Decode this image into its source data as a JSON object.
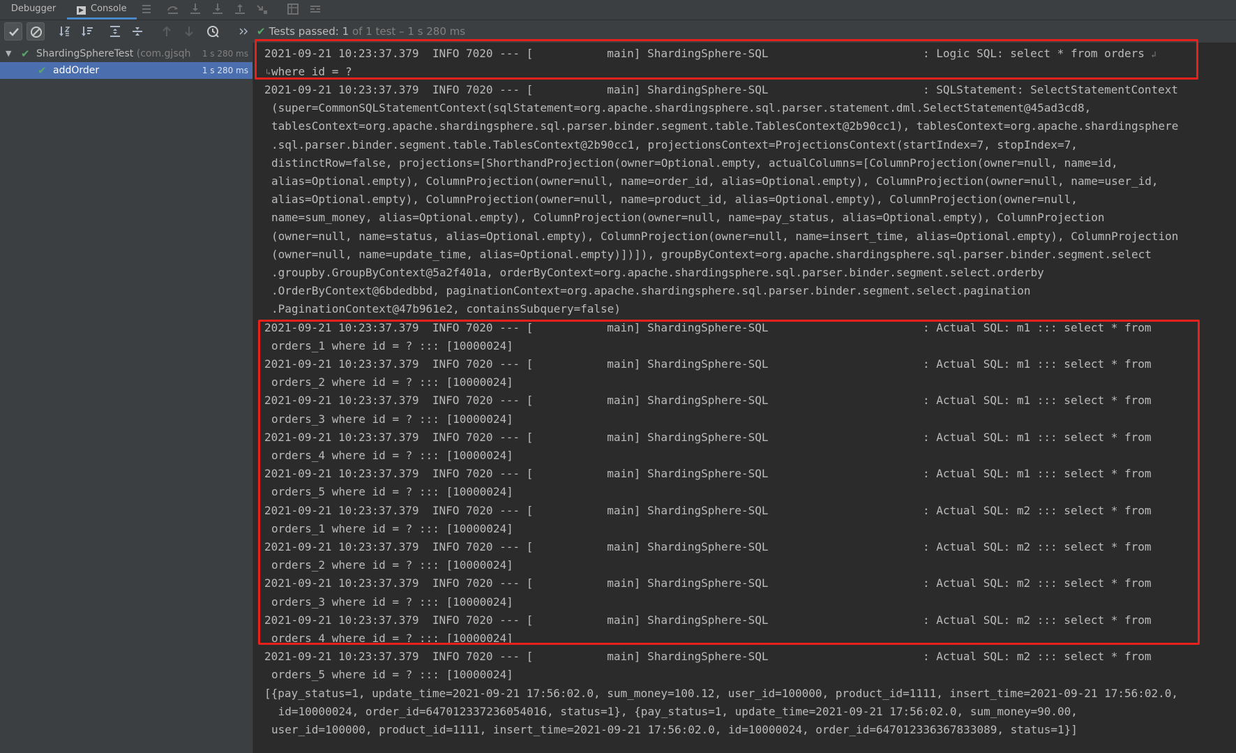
{
  "tabs": {
    "debugger": "Debugger",
    "console": "Console"
  },
  "status": {
    "prefix": "Tests passed:",
    "count": "1",
    "detail": "of 1 test – 1 s 280 ms"
  },
  "tree": {
    "root": {
      "name": "ShardingSphereTest",
      "pkg": "(com.gjsqh",
      "time": "1 s 280 ms"
    },
    "child": {
      "name": "addOrder",
      "time": "1 s 280 ms"
    }
  },
  "console": {
    "logic": {
      "line1": "2021-09-21 10:23:37.379  INFO 7020 --- [           main] ShardingSphere-SQL                       : Logic SQL: select * from orders ",
      "line2": "where id = ?"
    },
    "statement": [
      "2021-09-21 10:23:37.379  INFO 7020 --- [           main] ShardingSphere-SQL                       : SQLStatement: SelectStatementContext",
      "(super=CommonSQLStatementContext(sqlStatement=org.apache.shardingsphere.sql.parser.statement.dml.SelectStatement@45ad3cd8,",
      "tablesContext=org.apache.shardingsphere.sql.parser.binder.segment.table.TablesContext@2b90cc1), tablesContext=org.apache.shardingsphere",
      ".sql.parser.binder.segment.table.TablesContext@2b90cc1, projectionsContext=ProjectionsContext(startIndex=7, stopIndex=7,",
      "distinctRow=false, projections=[ShorthandProjection(owner=Optional.empty, actualColumns=[ColumnProjection(owner=null, name=id,",
      "alias=Optional.empty), ColumnProjection(owner=null, name=order_id, alias=Optional.empty), ColumnProjection(owner=null, name=user_id,",
      "alias=Optional.empty), ColumnProjection(owner=null, name=product_id, alias=Optional.empty), ColumnProjection(owner=null,",
      "name=sum_money, alias=Optional.empty), ColumnProjection(owner=null, name=pay_status, alias=Optional.empty), ColumnProjection",
      "(owner=null, name=status, alias=Optional.empty), ColumnProjection(owner=null, name=insert_time, alias=Optional.empty), ColumnProjection",
      "(owner=null, name=update_time, alias=Optional.empty)])]), groupByContext=org.apache.shardingsphere.sql.parser.binder.segment.select",
      ".groupby.GroupByContext@5a2f401a, orderByContext=org.apache.shardingsphere.sql.parser.binder.segment.select.orderby",
      ".OrderByContext@6bdedbbd, paginationContext=org.apache.shardingsphere.sql.parser.binder.segment.select.pagination",
      ".PaginationContext@47b961e2, containsSubquery=false)"
    ],
    "actual": [
      {
        "head": "2021-09-21 10:23:37.379  INFO 7020 --- [           main] ShardingSphere-SQL                       : Actual SQL: m1 ::: select * from",
        "tail": "orders_1 where id = ? ::: [10000024]"
      },
      {
        "head": "2021-09-21 10:23:37.379  INFO 7020 --- [           main] ShardingSphere-SQL                       : Actual SQL: m1 ::: select * from",
        "tail": "orders_2 where id = ? ::: [10000024]"
      },
      {
        "head": "2021-09-21 10:23:37.379  INFO 7020 --- [           main] ShardingSphere-SQL                       : Actual SQL: m1 ::: select * from",
        "tail": "orders_3 where id = ? ::: [10000024]"
      },
      {
        "head": "2021-09-21 10:23:37.379  INFO 7020 --- [           main] ShardingSphere-SQL                       : Actual SQL: m1 ::: select * from",
        "tail": "orders_4 where id = ? ::: [10000024]"
      },
      {
        "head": "2021-09-21 10:23:37.379  INFO 7020 --- [           main] ShardingSphere-SQL                       : Actual SQL: m1 ::: select * from",
        "tail": "orders_5 where id = ? ::: [10000024]"
      },
      {
        "head": "2021-09-21 10:23:37.379  INFO 7020 --- [           main] ShardingSphere-SQL                       : Actual SQL: m2 ::: select * from",
        "tail": "orders_1 where id = ? ::: [10000024]"
      },
      {
        "head": "2021-09-21 10:23:37.379  INFO 7020 --- [           main] ShardingSphere-SQL                       : Actual SQL: m2 ::: select * from",
        "tail": "orders_2 where id = ? ::: [10000024]"
      },
      {
        "head": "2021-09-21 10:23:37.379  INFO 7020 --- [           main] ShardingSphere-SQL                       : Actual SQL: m2 ::: select * from",
        "tail": "orders_3 where id = ? ::: [10000024]"
      },
      {
        "head": "2021-09-21 10:23:37.379  INFO 7020 --- [           main] ShardingSphere-SQL                       : Actual SQL: m2 ::: select * from",
        "tail": "orders_4 where id = ? ::: [10000024]"
      },
      {
        "head": "2021-09-21 10:23:37.379  INFO 7020 --- [           main] ShardingSphere-SQL                       : Actual SQL: m2 ::: select * from",
        "tail": "orders_5 where id = ? ::: [10000024]"
      }
    ],
    "result": [
      "[{pay_status=1, update_time=2021-09-21 17:56:02.0, sum_money=100.12, user_id=100000, product_id=1111, insert_time=2021-09-21 17:56:02.0,",
      " id=10000024, order_id=647012337236054016, status=1}, {pay_status=1, update_time=2021-09-21 17:56:02.0, sum_money=90.00,",
      "user_id=100000, product_id=1111, insert_time=2021-09-21 17:56:02.0, id=10000024, order_id=647012336367833089, status=1}]"
    ]
  },
  "colors": {
    "highlight_box": "#e8211d",
    "pass_green": "#59a869",
    "selection": "#4b6eaf"
  }
}
